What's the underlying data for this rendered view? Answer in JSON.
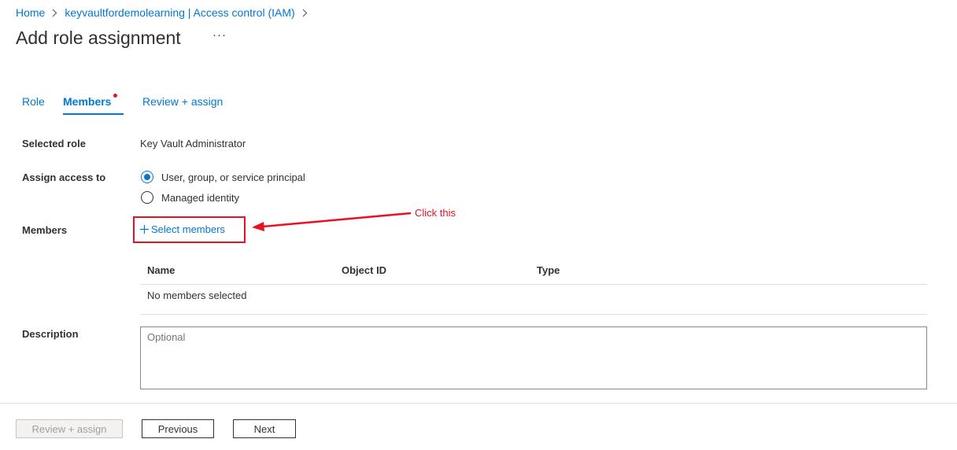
{
  "breadcrumb": {
    "items": [
      {
        "label": "Home"
      },
      {
        "label": "keyvaultfordemolearning | Access control (IAM)"
      }
    ]
  },
  "page": {
    "title": "Add role assignment",
    "more_label": "···"
  },
  "tabs": [
    {
      "label": "Role"
    },
    {
      "label": "Members",
      "active": true,
      "has_indicator": true
    },
    {
      "label": "Review + assign"
    }
  ],
  "form": {
    "selected_role_label": "Selected role",
    "selected_role_value": "Key Vault Administrator",
    "assign_access_label": "Assign access to",
    "assign_options": [
      {
        "label": "User, group, or service principal",
        "checked": true
      },
      {
        "label": "Managed identity",
        "checked": false
      }
    ],
    "members_label": "Members",
    "select_members_label": "Select members",
    "select_members_icon": "plus-icon",
    "annotation": "Click this",
    "table": {
      "columns": [
        "Name",
        "Object ID",
        "Type"
      ],
      "empty_text": "No members selected"
    },
    "description_label": "Description",
    "description_placeholder": "Optional"
  },
  "footer": {
    "review_assign_label": "Review + assign",
    "previous_label": "Previous",
    "next_label": "Next"
  },
  "colors": {
    "accent": "#0078d4",
    "annotation": "#e81123",
    "text": "#323130"
  }
}
